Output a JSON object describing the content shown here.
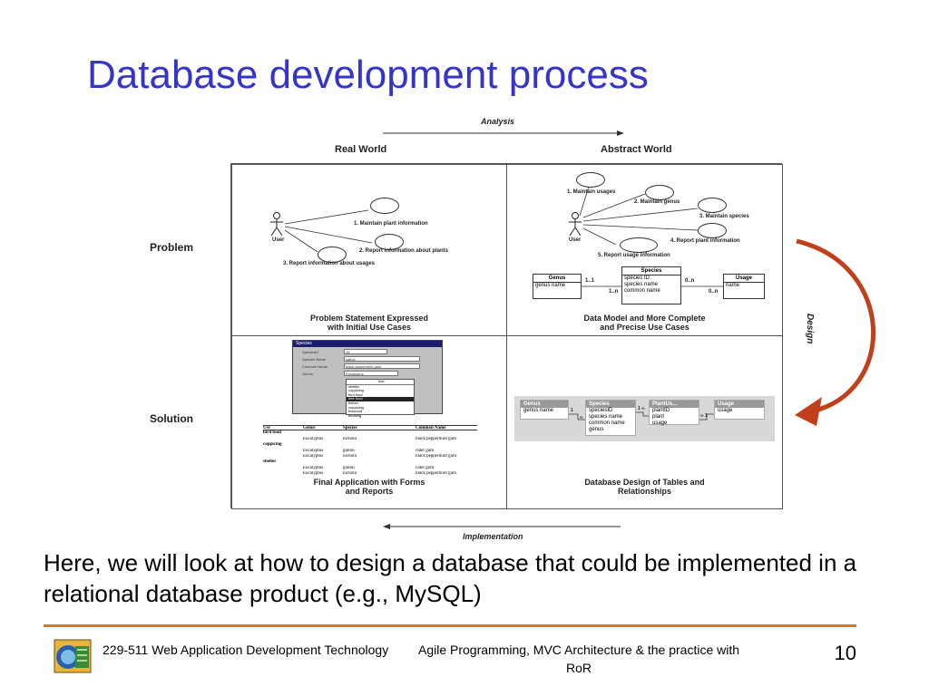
{
  "slide": {
    "title": "Database development process",
    "body_text": "Here, we will look at how to design a database that could be implemented in a relational database product (e.g., MySQL)"
  },
  "diagram": {
    "analysis_label": "Analysis",
    "implementation_label": "Implementation",
    "design_label": "Design",
    "col_real_world": "Real World",
    "col_abstract_world": "Abstract World",
    "row_problem": "Problem",
    "row_solution": "Solution",
    "cells": {
      "tl": {
        "caption": "Problem Statement Expressed\nwith Initial Use Cases",
        "actor": "User",
        "use_cases": [
          "1. Maintain plant information",
          "2. Report information about plants",
          "3. Report information about usages"
        ]
      },
      "tr": {
        "caption": "Data Model and More Complete\nand Precise Use Cases",
        "actor": "User",
        "use_cases": [
          "1. Maintain usages",
          "2. Maintain genus",
          "3. Maintain species",
          "4. Report plant information",
          "5. Report usage information"
        ],
        "entities": {
          "genus": {
            "name": "Genus",
            "fields": [
              "genus name"
            ]
          },
          "species": {
            "name": "Species",
            "fields": [
              "species ID",
              "species name",
              "common name"
            ]
          },
          "usage": {
            "name": "Usage",
            "fields": [
              "name"
            ]
          }
        },
        "multiplicities": [
          "1..1",
          "1..n",
          "0..n",
          "0..n"
        ]
      },
      "bl": {
        "caption": "Final Application with Forms\nand Reports",
        "form": {
          "window_title": "Species",
          "labels": [
            "SpeciesID",
            "Species Name",
            "Common Name",
            "Genus"
          ],
          "values": [
            "26",
            "sativa",
            "black peppermint gum",
            "Eucalyptus"
          ],
          "list_header": "Use",
          "list_items": [
            "shelter",
            "coppicing",
            "bird food",
            "bee food",
            "timber",
            "coppicing",
            "firewood",
            "bedding"
          ],
          "list_selected_index": 3
        },
        "report": {
          "headers": [
            "Use",
            "Genus",
            "Species",
            "Common Name"
          ],
          "rows": [
            [
              "bird food",
              "",
              "",
              ""
            ],
            [
              "",
              "Eucalyptus",
              "nicholii",
              "black peppermint gum"
            ],
            [
              "coppicing",
              "",
              "",
              ""
            ],
            [
              "",
              "Eucalyptus",
              "gunnii",
              "cider gum"
            ],
            [
              "",
              "Eucalyptus",
              "nicholii",
              "black peppermint gum"
            ],
            [
              "shelter",
              "",
              "",
              ""
            ],
            [
              "",
              "Eucalyptus",
              "gunnii",
              "cider gum"
            ],
            [
              "",
              "Eucalyptus",
              "nicholii",
              "black peppermint gum"
            ]
          ]
        }
      },
      "br": {
        "caption": "Database Design of Tables and\nRelationships",
        "tables": {
          "genus": {
            "name": "Genus",
            "fields": [
              "genus name"
            ]
          },
          "species": {
            "name": "Species",
            "fields": [
              "speciesID",
              "species name",
              "common name",
              "genus"
            ]
          },
          "plantuse": {
            "name": "PlantUs...",
            "fields": [
              "plantID",
              "plant",
              "usage"
            ]
          },
          "usage": {
            "name": "Usage",
            "fields": [
              "usage"
            ]
          }
        },
        "relationship_labels": [
          "1",
          "∞",
          "1 ∞",
          "∞ 1"
        ]
      }
    },
    "colors": {
      "design_arrow": "#c0401c",
      "title": "#3535c8",
      "footer_rule": "#d8731e"
    }
  },
  "footer": {
    "course": "229-511 Web Application Development Technology",
    "topic": "Agile Programming, MVC Architecture & the practice with RoR",
    "slide_number": "10",
    "logo_icon": "university-logo-icon"
  }
}
